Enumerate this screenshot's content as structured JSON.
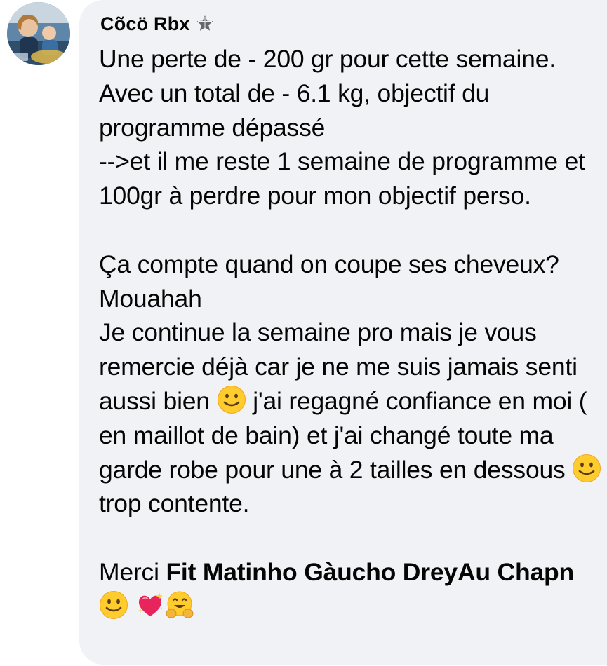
{
  "comment": {
    "author": "Cõcö Rbx",
    "author_badge_icon": "top-fan-star-badge-icon",
    "paragraphs": [
      "Une perte de - 200 gr pour cette semaine. Avec un total de - 6.1 kg, objectif du programme dépassé\n-->et il me reste 1 semaine de programme et 100gr à perdre pour mon objectif perso.",
      "Ça compte quand on coupe ses cheveux? Mouahah"
    ],
    "p3": {
      "seg1": "Je continue la semaine pro mais je vous remercie déjà car je ne me suis jamais senti aussi bien ",
      "seg2": " j'ai regagné confiance en moi ( en maillot de bain)  et j'ai changé toute ma garde robe pour une à 2 tailles en dessous ",
      "seg3": " trop contente."
    },
    "thanks": {
      "prefix": "Merci ",
      "mention": "Fit Matinho Gàucho DreyAu Chapn"
    },
    "emojis": [
      "slightly-smiling-face",
      "sparkling-heart",
      "hugging-face"
    ]
  },
  "colors": {
    "bubble_bg": "#f0f2f5",
    "text": "#050505"
  }
}
